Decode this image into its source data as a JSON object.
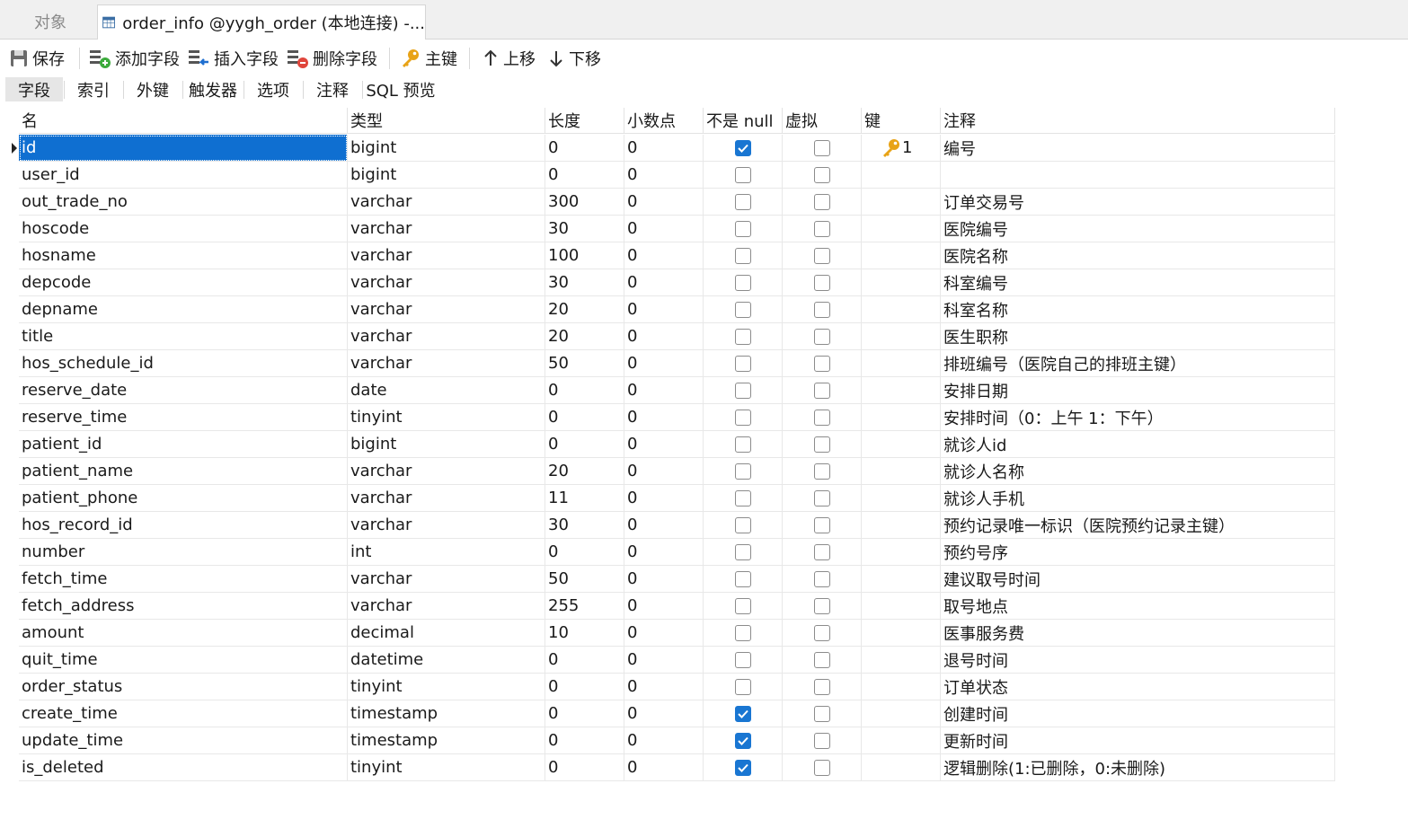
{
  "window": {
    "objects_tab": "对象",
    "table_tab": "order_info @yygh_order (本地连接) -..."
  },
  "toolbar": {
    "save": "保存",
    "add_field": "添加字段",
    "insert_field": "插入字段",
    "delete_field": "删除字段",
    "primary_key": "主键",
    "move_up": "上移",
    "move_down": "下移"
  },
  "subtabs": [
    "字段",
    "索引",
    "外键",
    "触发器",
    "选项",
    "注释",
    "SQL 预览"
  ],
  "columns": [
    "名",
    "类型",
    "长度",
    "小数点",
    "不是 null",
    "虚拟",
    "键",
    "注释"
  ],
  "rows": [
    {
      "name": "id",
      "type": "bigint",
      "length": "0",
      "decimal": "0",
      "not_null": true,
      "virtual": false,
      "key": "1",
      "comment": "编号"
    },
    {
      "name": "user_id",
      "type": "bigint",
      "length": "0",
      "decimal": "0",
      "not_null": false,
      "virtual": false,
      "key": "",
      "comment": ""
    },
    {
      "name": "out_trade_no",
      "type": "varchar",
      "length": "300",
      "decimal": "0",
      "not_null": false,
      "virtual": false,
      "key": "",
      "comment": "订单交易号"
    },
    {
      "name": "hoscode",
      "type": "varchar",
      "length": "30",
      "decimal": "0",
      "not_null": false,
      "virtual": false,
      "key": "",
      "comment": "医院编号"
    },
    {
      "name": "hosname",
      "type": "varchar",
      "length": "100",
      "decimal": "0",
      "not_null": false,
      "virtual": false,
      "key": "",
      "comment": "医院名称"
    },
    {
      "name": "depcode",
      "type": "varchar",
      "length": "30",
      "decimal": "0",
      "not_null": false,
      "virtual": false,
      "key": "",
      "comment": "科室编号"
    },
    {
      "name": "depname",
      "type": "varchar",
      "length": "20",
      "decimal": "0",
      "not_null": false,
      "virtual": false,
      "key": "",
      "comment": "科室名称"
    },
    {
      "name": "title",
      "type": "varchar",
      "length": "20",
      "decimal": "0",
      "not_null": false,
      "virtual": false,
      "key": "",
      "comment": "医生职称"
    },
    {
      "name": "hos_schedule_id",
      "type": "varchar",
      "length": "50",
      "decimal": "0",
      "not_null": false,
      "virtual": false,
      "key": "",
      "comment": "排班编号（医院自己的排班主键）"
    },
    {
      "name": "reserve_date",
      "type": "date",
      "length": "0",
      "decimal": "0",
      "not_null": false,
      "virtual": false,
      "key": "",
      "comment": "安排日期"
    },
    {
      "name": "reserve_time",
      "type": "tinyint",
      "length": "0",
      "decimal": "0",
      "not_null": false,
      "virtual": false,
      "key": "",
      "comment": "安排时间（0：上午 1：下午）"
    },
    {
      "name": "patient_id",
      "type": "bigint",
      "length": "0",
      "decimal": "0",
      "not_null": false,
      "virtual": false,
      "key": "",
      "comment": "就诊人id"
    },
    {
      "name": "patient_name",
      "type": "varchar",
      "length": "20",
      "decimal": "0",
      "not_null": false,
      "virtual": false,
      "key": "",
      "comment": "就诊人名称"
    },
    {
      "name": "patient_phone",
      "type": "varchar",
      "length": "11",
      "decimal": "0",
      "not_null": false,
      "virtual": false,
      "key": "",
      "comment": "就诊人手机"
    },
    {
      "name": "hos_record_id",
      "type": "varchar",
      "length": "30",
      "decimal": "0",
      "not_null": false,
      "virtual": false,
      "key": "",
      "comment": "预约记录唯一标识（医院预约记录主键）"
    },
    {
      "name": "number",
      "type": "int",
      "length": "0",
      "decimal": "0",
      "not_null": false,
      "virtual": false,
      "key": "",
      "comment": "预约号序"
    },
    {
      "name": "fetch_time",
      "type": "varchar",
      "length": "50",
      "decimal": "0",
      "not_null": false,
      "virtual": false,
      "key": "",
      "comment": "建议取号时间"
    },
    {
      "name": "fetch_address",
      "type": "varchar",
      "length": "255",
      "decimal": "0",
      "not_null": false,
      "virtual": false,
      "key": "",
      "comment": "取号地点"
    },
    {
      "name": "amount",
      "type": "decimal",
      "length": "10",
      "decimal": "0",
      "not_null": false,
      "virtual": false,
      "key": "",
      "comment": "医事服务费"
    },
    {
      "name": "quit_time",
      "type": "datetime",
      "length": "0",
      "decimal": "0",
      "not_null": false,
      "virtual": false,
      "key": "",
      "comment": "退号时间"
    },
    {
      "name": "order_status",
      "type": "tinyint",
      "length": "0",
      "decimal": "0",
      "not_null": false,
      "virtual": false,
      "key": "",
      "comment": "订单状态"
    },
    {
      "name": "create_time",
      "type": "timestamp",
      "length": "0",
      "decimal": "0",
      "not_null": true,
      "virtual": false,
      "key": "",
      "comment": "创建时间"
    },
    {
      "name": "update_time",
      "type": "timestamp",
      "length": "0",
      "decimal": "0",
      "not_null": true,
      "virtual": false,
      "key": "",
      "comment": "更新时间"
    },
    {
      "name": "is_deleted",
      "type": "tinyint",
      "length": "0",
      "decimal": "0",
      "not_null": true,
      "virtual": false,
      "key": "",
      "comment": "逻辑删除(1:已删除，0:未删除)"
    }
  ],
  "colors": {
    "selection": "#0f6fd1",
    "checkbox_checked": "#1976d2",
    "key_icon": "#e8a317"
  }
}
